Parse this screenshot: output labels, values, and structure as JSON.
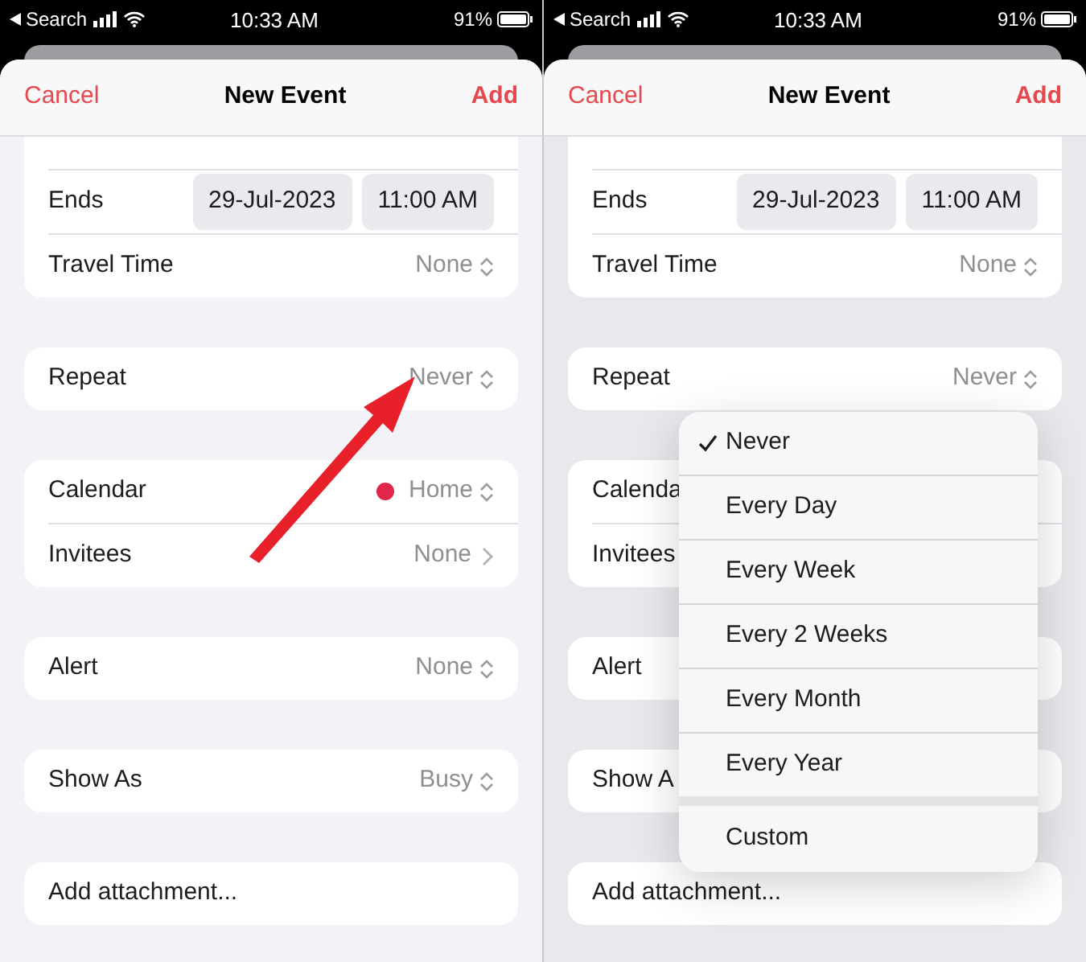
{
  "panels": [
    {
      "status_bar": {
        "back_label": "Search",
        "time": "10:33 AM",
        "battery": "91%"
      },
      "nav": {
        "cancel": "Cancel",
        "title": "New Event",
        "add": "Add"
      },
      "groups": [
        [
          {
            "kind": "datetime",
            "label": "Ends",
            "date": "29-Jul-2023",
            "time": "11:00 AM"
          },
          {
            "kind": "select",
            "label": "Travel Time",
            "value": "None"
          }
        ],
        [
          {
            "kind": "select",
            "label": "Repeat",
            "value": "Never"
          }
        ],
        [
          {
            "kind": "calendar",
            "label": "Calendar",
            "value": "Home",
            "color": "#e0264a"
          },
          {
            "kind": "link",
            "label": "Invitees",
            "value": "None"
          }
        ],
        [
          {
            "kind": "select",
            "label": "Alert",
            "value": "None"
          }
        ],
        [
          {
            "kind": "select",
            "label": "Show As",
            "value": "Busy"
          }
        ],
        [
          {
            "kind": "action",
            "label": "Add attachment..."
          }
        ]
      ],
      "overlay": {
        "kind": "arrow"
      }
    },
    {
      "status_bar": {
        "back_label": "Search",
        "time": "10:33 AM",
        "battery": "91%"
      },
      "nav": {
        "cancel": "Cancel",
        "title": "New Event",
        "add": "Add"
      },
      "groups": [
        [
          {
            "kind": "datetime",
            "label": "Ends",
            "date": "29-Jul-2023",
            "time": "11:00 AM"
          },
          {
            "kind": "select",
            "label": "Travel Time",
            "value": "None"
          }
        ],
        [
          {
            "kind": "select",
            "label": "Repeat",
            "value": "Never"
          }
        ],
        [
          {
            "kind": "calendar",
            "label": "Calenda"
          },
          {
            "kind": "link",
            "label": "Invitees"
          }
        ],
        [
          {
            "kind": "select",
            "label": "Alert"
          }
        ],
        [
          {
            "kind": "select",
            "label": "Show A"
          }
        ],
        [
          {
            "kind": "action",
            "label": "Add attachment..."
          }
        ]
      ],
      "overlay": {
        "kind": "menu",
        "items": [
          {
            "kind": "option",
            "label": "Never",
            "selected": true
          },
          {
            "kind": "option",
            "label": "Every Day",
            "selected": false
          },
          {
            "kind": "option",
            "label": "Every Week",
            "selected": false
          },
          {
            "kind": "option",
            "label": "Every 2 Weeks",
            "selected": false
          },
          {
            "kind": "option",
            "label": "Every Month",
            "selected": false
          },
          {
            "kind": "option",
            "label": "Every Year",
            "selected": false
          },
          {
            "kind": "custom",
            "label": "Custom",
            "selected": false
          }
        ]
      }
    }
  ]
}
